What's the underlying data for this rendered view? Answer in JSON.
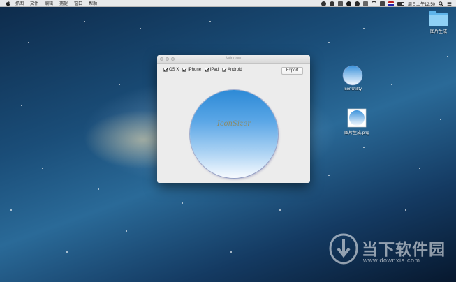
{
  "menubar": {
    "items": [
      "抓图",
      "文件",
      "编辑",
      "捕捉",
      "窗口",
      "帮助"
    ],
    "clock": "周日上午12:50"
  },
  "desktop": {
    "folder": {
      "label": "图片生成"
    },
    "app_icon": {
      "label": "IconUtility"
    },
    "png_file": {
      "label": "图片生成.png"
    }
  },
  "window": {
    "title": "Window",
    "options": [
      {
        "label": "OS X",
        "checked": true
      },
      {
        "label": "iPhone",
        "checked": true
      },
      {
        "label": "iPad",
        "checked": true
      },
      {
        "label": "Android",
        "checked": true
      }
    ],
    "export_label": "Export",
    "preview_text": "IconSizer"
  },
  "watermark": {
    "text": "当下软件园",
    "url": "www.downxia.com"
  },
  "colors": {
    "preview_top": "#2d8ad6",
    "preview_bottom": "#f8fbff",
    "window_bg": "#ececec"
  }
}
